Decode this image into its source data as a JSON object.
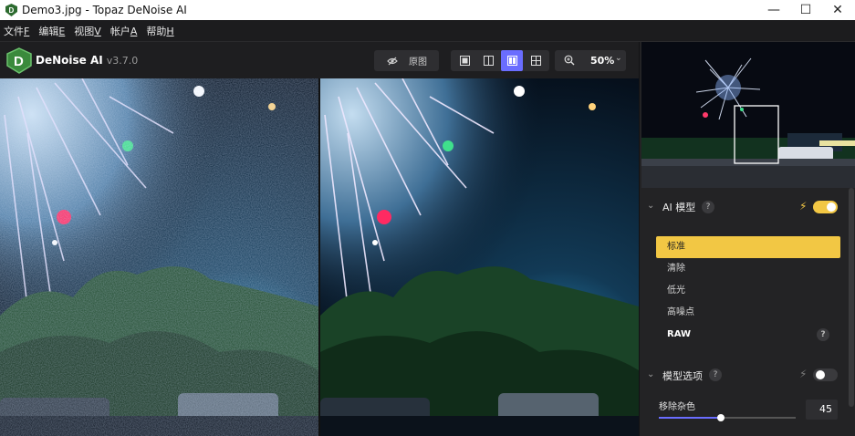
{
  "window": {
    "title": "Demo3.jpg - Topaz DeNoise AI",
    "minimize": "—",
    "maximize": "☐",
    "close": "✕"
  },
  "menu": [
    {
      "label": "文件",
      "key": "F"
    },
    {
      "label": "编辑",
      "key": "E"
    },
    {
      "label": "视图",
      "key": "V"
    },
    {
      "label": "帐户",
      "key": "A"
    },
    {
      "label": "帮助",
      "key": "H"
    }
  ],
  "toolbar": {
    "app_name": "DeNoise AI",
    "version": "v3.7.0",
    "original_label": "原图",
    "zoom": "50%",
    "view_modes": [
      "single-view",
      "split-view",
      "side-by-side-view",
      "comparison-grid-view"
    ],
    "active_view": "side-by-side-view"
  },
  "ai_model": {
    "title": "AI 模型",
    "help": "?",
    "enabled": true,
    "models": [
      "标准",
      "清除",
      "低光",
      "高噪点",
      "RAW"
    ],
    "selected": "标准"
  },
  "model_options": {
    "title": "模型选项",
    "help": "?",
    "enabled": false,
    "remove_noise_label": "移除杂色",
    "remove_noise_value": "45",
    "remove_noise_fraction": 0.45
  },
  "colors": {
    "accent_yellow": "#f2c744",
    "accent_blue": "#6a6dff",
    "panel": "#232325"
  }
}
